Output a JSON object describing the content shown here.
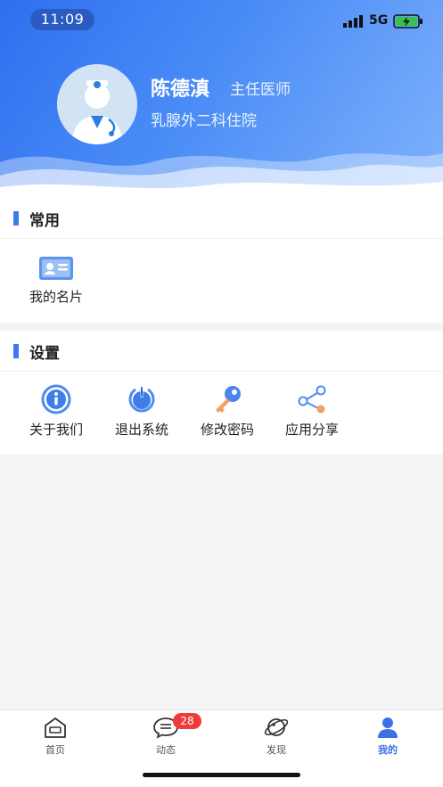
{
  "status": {
    "time": "11:09",
    "network": "5G"
  },
  "profile": {
    "name": "陈德滇",
    "title": "主任医师",
    "department": "乳腺外二科住院"
  },
  "common": {
    "title": "常用",
    "items": [
      {
        "label": "我的名片",
        "icon": "id-card-icon"
      }
    ]
  },
  "settings": {
    "title": "设置",
    "items": [
      {
        "label": "关于我们",
        "icon": "info-icon"
      },
      {
        "label": "退出系统",
        "icon": "power-icon"
      },
      {
        "label": "修改密码",
        "icon": "key-icon"
      },
      {
        "label": "应用分享",
        "icon": "share-icon"
      }
    ]
  },
  "tabbar": {
    "items": [
      {
        "label": "首页",
        "icon": "home-icon"
      },
      {
        "label": "动态",
        "icon": "chat-icon",
        "badge": "28"
      },
      {
        "label": "发现",
        "icon": "planet-icon"
      },
      {
        "label": "我的",
        "icon": "person-icon",
        "active": true
      }
    ]
  },
  "colors": {
    "accent": "#3a72e6",
    "badge": "#ef3b3b",
    "header": "#4a8cf6"
  }
}
